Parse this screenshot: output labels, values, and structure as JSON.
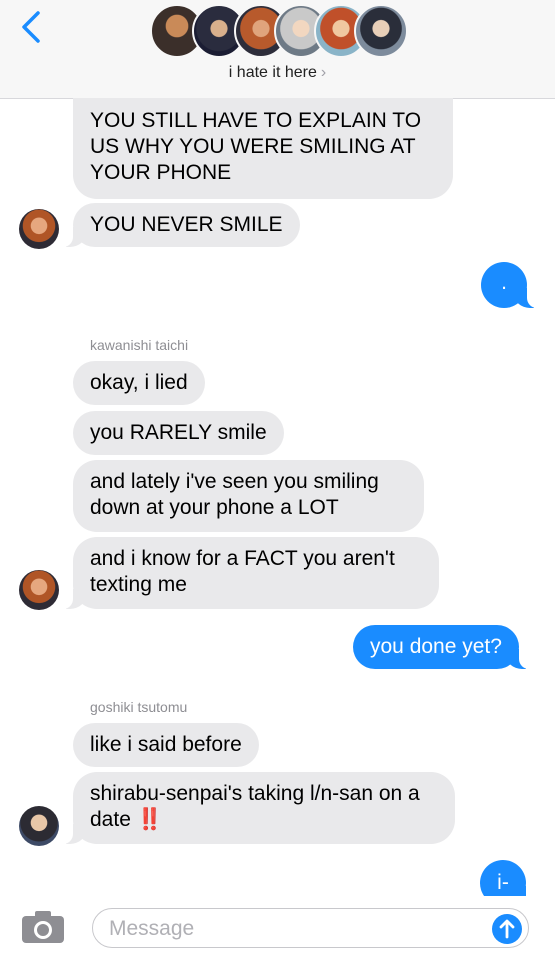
{
  "header": {
    "back_icon": "chevron-left-icon",
    "group_name": "i hate it here",
    "chevron": "›"
  },
  "messages": [
    {
      "text": "YOU STILL HAVE TO EXPLAIN TO US WHY YOU WERE SMILING AT YOUR PHONE"
    },
    {
      "text": "YOU NEVER SMILE"
    },
    {
      "text": "."
    },
    {
      "sender": "kawanishi taichi"
    },
    {
      "text": "okay, i lied"
    },
    {
      "text": "you RARELY smile"
    },
    {
      "text": "and lately i've seen you smiling down at your phone a LOT"
    },
    {
      "text": "and i know for a FACT you aren't texting me"
    },
    {
      "text": "you done yet?"
    },
    {
      "sender": "goshiki tsutomu"
    },
    {
      "text": "like i said before"
    },
    {
      "text": "shirabu-senpai's taking l/n-san on a date",
      "emoji": "‼️"
    },
    {
      "text": "i-"
    }
  ],
  "composer": {
    "placeholder": "Message",
    "camera_icon": "camera-icon",
    "send_icon": "arrow-up-icon"
  },
  "colors": {
    "incoming_bubble": "#e9e9eb",
    "outgoing_bubble": "#1a8cff",
    "accent": "#1a8cff"
  }
}
